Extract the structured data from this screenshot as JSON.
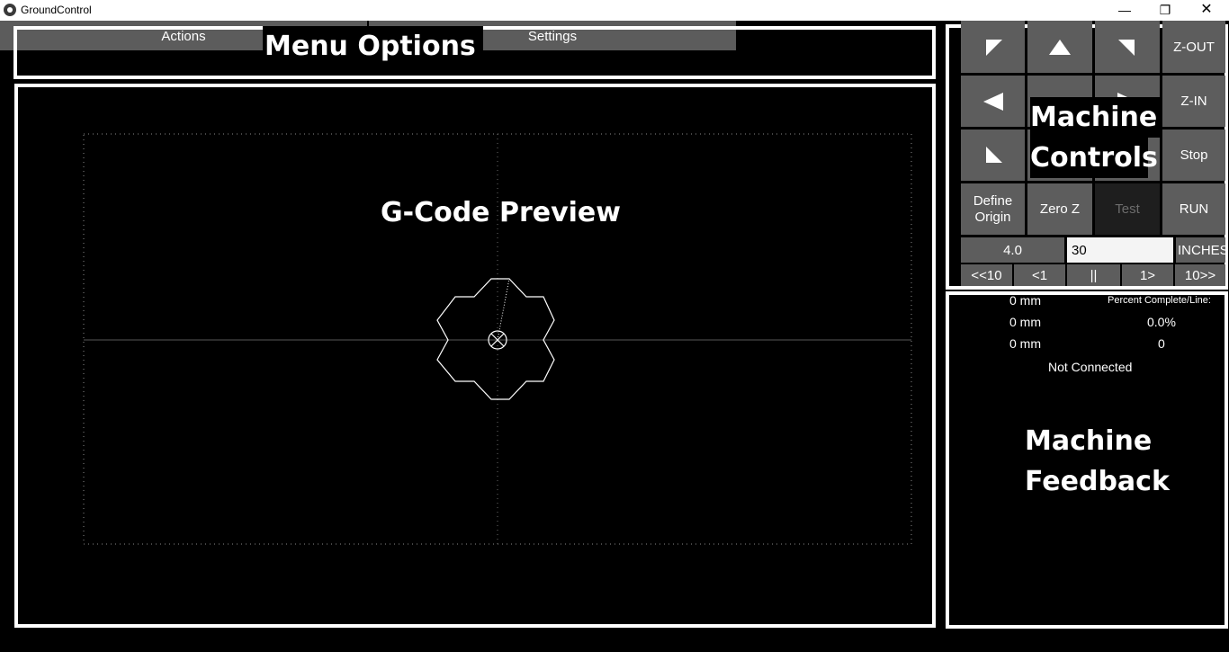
{
  "window": {
    "title": "GroundControl"
  },
  "menu": {
    "actions_label": "Actions",
    "settings_label": "Settings"
  },
  "annotations": {
    "menu_options": "Menu Options",
    "gcode_preview": "G-Code Preview",
    "machine_controls_1": "Machine",
    "machine_controls_2": "Controls",
    "machine_feedback_1": "Machine",
    "machine_feedback_2": "Feedback"
  },
  "controls": {
    "z_out": "Z-OUT",
    "z_in": "Z-IN",
    "stop": "Stop",
    "define_origin_1": "Define",
    "define_origin_2": "Origin",
    "zero_z": "Zero Z",
    "test": "Test",
    "run": "RUN",
    "step_size": "4.0",
    "step_input": "30",
    "units": "INCHES",
    "back10": "<<10",
    "back1": "<1",
    "pause": "||",
    "fwd1": "1>",
    "fwd10": "10>>"
  },
  "feedback": {
    "x_pos": "0 mm",
    "y_pos": "0 mm",
    "z_pos": "0 mm",
    "percent_label": "Percent Complete/Line:",
    "percent_value": "0.0%",
    "line_value": "0",
    "status": "Not Connected"
  },
  "colors": {
    "background": "#000000",
    "button": "#5d5d5d",
    "highlight": "#ffffff"
  }
}
